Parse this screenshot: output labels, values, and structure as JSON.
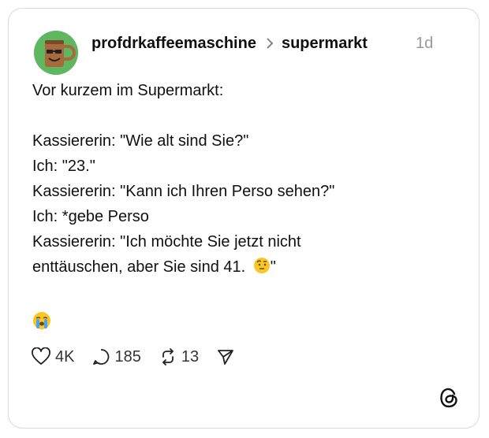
{
  "post": {
    "username": "profdrkaffeemaschine",
    "community": "supermarkt",
    "time": "1d",
    "text_lines": [
      "Vor kurzem im Supermarkt:",
      "",
      "Kassiererin: \"Wie alt sind Sie?\"",
      "Ich: \"23.\"",
      "Kassiererin: \"Kann ich Ihren Perso sehen?\"",
      "Ich: *gebe Perso",
      "Kassiererin: \"Ich möchte Sie jetzt nicht",
      "enttäuschen, aber Sie sind 41. ",
      "\"",
      "",
      ""
    ],
    "likes": "4K",
    "replies": "185",
    "reposts": "13"
  },
  "icons": {
    "avatar": "coffee-mug-character-avatar",
    "chevron": "chevron-right-icon",
    "inline_emoji": "face-with-raised-eyebrow-emoji",
    "big_emoji": "loudly-crying-face-emoji",
    "like": "heart-icon",
    "reply": "speech-bubble-icon",
    "repost": "repost-icon",
    "share": "send-icon",
    "logo": "threads-logo-icon"
  },
  "colors": {
    "text": "#101010",
    "muted": "#999999",
    "border": "#d9d9d9"
  }
}
